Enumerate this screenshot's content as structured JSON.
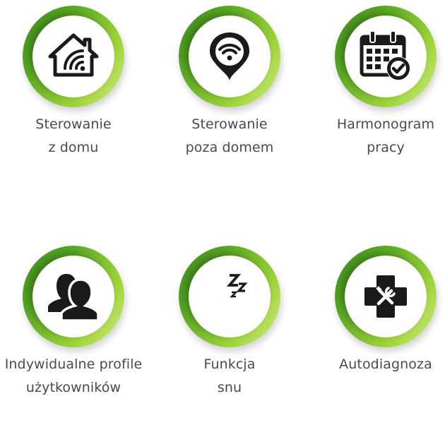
{
  "colors": {
    "ring_dark": "#3c8c1e",
    "ring_light": "#d2ec85",
    "icon": "#1a1a1a",
    "text": "#4a4a4a"
  },
  "features": [
    {
      "icon": "smart-home-wifi-icon",
      "line1": "Sterowanie",
      "line2": "z domu"
    },
    {
      "icon": "wifi-location-pin-icon",
      "line1": "Sterowanie",
      "line2": "poza domem"
    },
    {
      "icon": "calendar-check-icon",
      "line1": "Harmonogram",
      "line2": "pracy"
    },
    {
      "icon": "users-icon",
      "line1": "Indywidualne profile",
      "line2": "użytkowników"
    },
    {
      "icon": "sleep-moon-icon",
      "line1": "Funkcja",
      "line2": "snu"
    },
    {
      "icon": "tools-cross-icon",
      "line1": "Autodiagnoza",
      "line2": ""
    }
  ]
}
